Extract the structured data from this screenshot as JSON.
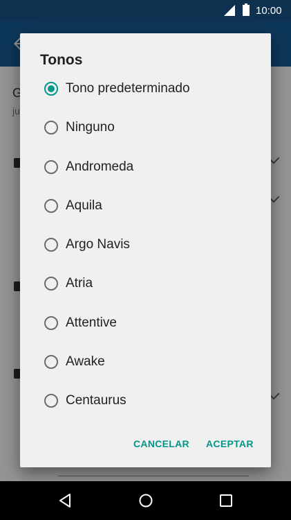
{
  "status_bar": {
    "time": "10:00",
    "icons": [
      "signal-icon",
      "battery-icon"
    ]
  },
  "background": {
    "partial_letter_top": "G",
    "partial_letters_sub": "ju"
  },
  "dialog": {
    "title": "Tonos",
    "options": [
      {
        "label": "Tono predeterminado",
        "selected": true
      },
      {
        "label": "Ninguno",
        "selected": false
      },
      {
        "label": "Andromeda",
        "selected": false
      },
      {
        "label": "Aquila",
        "selected": false
      },
      {
        "label": "Argo Navis",
        "selected": false
      },
      {
        "label": "Atria",
        "selected": false
      },
      {
        "label": "Attentive",
        "selected": false
      },
      {
        "label": "Awake",
        "selected": false
      },
      {
        "label": "Centaurus",
        "selected": false
      }
    ],
    "cancel_label": "CANCELAR",
    "accept_label": "ACEPTAR"
  },
  "nav_bar": {
    "icons": [
      "back-icon",
      "home-icon",
      "recents-icon"
    ]
  },
  "colors": {
    "status_bar": "#0f3150",
    "app_bar": "#17609a",
    "accent": "#009688",
    "dialog_bg": "#f0f0f0"
  }
}
